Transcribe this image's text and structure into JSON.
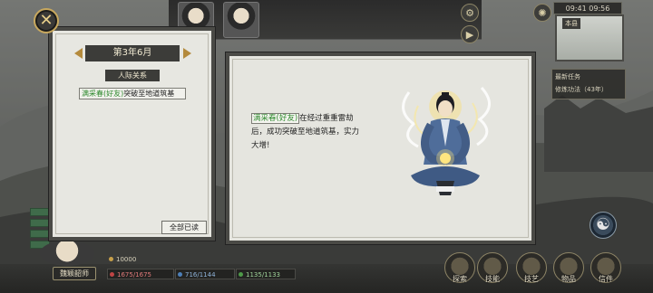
{
  "left_panel": {
    "date": "第3年6月",
    "section": "人际关系",
    "entries": [
      {
        "name": "满采春(好友)",
        "text": "突破至地道筑基"
      }
    ],
    "read_all": "全部已读"
  },
  "detail_panel": {
    "name": "满采春(好友)",
    "text": "在经过重重雷劫后，成功突破至地道筑基，实力大增!"
  },
  "hud": {
    "time": "09:41 09:56",
    "map_location": "本县",
    "quest_title": "最新任务",
    "quest_item": "修炼功法（43年）"
  },
  "player": {
    "name": "魏颖韶师"
  },
  "stats": {
    "hp": "1675/1675",
    "mp": "716/1144",
    "exp": "1135/1133",
    "money": "10000"
  },
  "menu": [
    {
      "label": "探索",
      "icon": "explore-icon"
    },
    {
      "label": "技能",
      "icon": "skill-icon"
    },
    {
      "label": "技艺",
      "icon": "craft-icon"
    },
    {
      "label": "物品",
      "icon": "item-icon"
    },
    {
      "label": "信件",
      "icon": "letter-icon"
    }
  ],
  "taiji_glyph": "☯",
  "colors": {
    "green_name": "#2e8a2e",
    "panel_bg": "#e7e7e1",
    "frame": "#4a4a46",
    "gold": "#c8a85e"
  }
}
